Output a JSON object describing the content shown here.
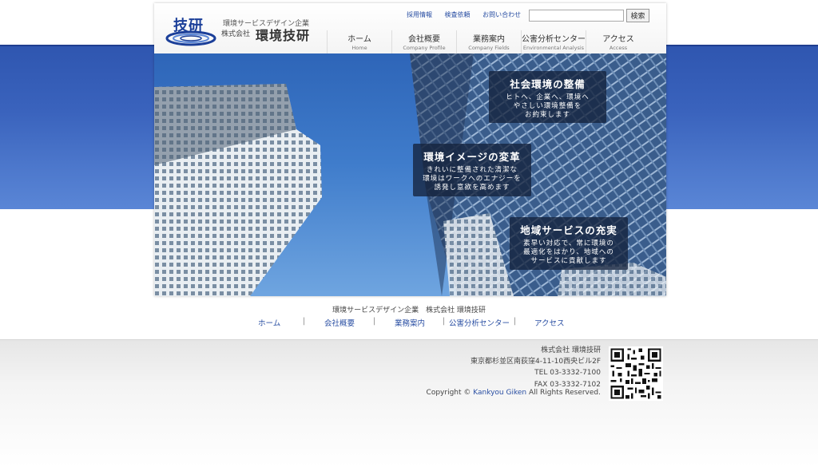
{
  "header": {
    "logo_text": "技研",
    "tagline": "環境サービスデザイン企業",
    "company_prefix": "株式会社",
    "company_name": "環境技研",
    "top_links": [
      "採用情報",
      "検査依頼",
      "お問い合わせ"
    ],
    "search": {
      "value": "",
      "button_label": "検索"
    }
  },
  "nav": [
    {
      "jp": "ホーム",
      "en": "Home"
    },
    {
      "jp": "会社概要",
      "en": "Company Profile"
    },
    {
      "jp": "業務案内",
      "en": "Company Fields"
    },
    {
      "jp": "公害分析センター",
      "en": "Environmental Analysis"
    },
    {
      "jp": "アクセス",
      "en": "Access"
    }
  ],
  "hero": {
    "captions": [
      {
        "title": "社会環境の整備",
        "lines": [
          "ヒトへ、企業へ、環境へ",
          "やさしい環境整備を",
          "お約束します"
        ]
      },
      {
        "title": "環境イメージの変革",
        "lines": [
          "きれいに整備された清潔な",
          "環境はワークへのエナジーを",
          "誘発し意欲を高めます"
        ]
      },
      {
        "title": "地域サービスの充実",
        "lines": [
          "素早い対応で、常に環境の",
          "最適化をはかり、地域への",
          "サービスに貢献します"
        ]
      }
    ]
  },
  "footer": {
    "company_line": "環境サービスデザイン企業　株式会社 環境技研",
    "nav": [
      "ホーム",
      "会社概要",
      "業務案内",
      "公害分析センター",
      "アクセス"
    ],
    "separator": "|",
    "address": {
      "name": "株式会社 環境技研",
      "street": "東京都杉並区南荻窪4-11-10西央ビル2F",
      "tel": "TEL 03-3332-7100",
      "fax": "FAX 03-3332-7102"
    },
    "copyright_prefix": "Copyright © ",
    "copyright_brand": "Kankyou Giken",
    "copyright_suffix": " All Rights Reserved."
  },
  "colors": {
    "brand_blue": "#2a4fa3",
    "band_blue": "#3a63bd"
  },
  "icons": {
    "logo": "globe-swirl-logo",
    "qr": "qr-code"
  }
}
